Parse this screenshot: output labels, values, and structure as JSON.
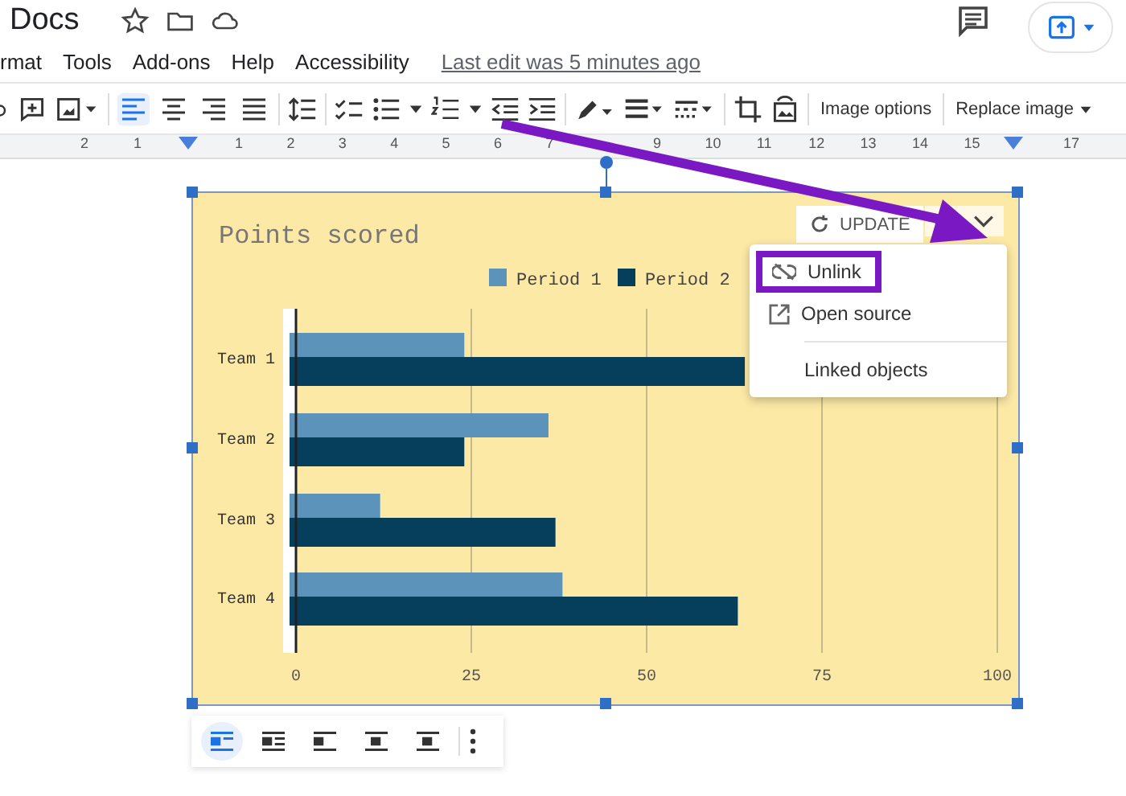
{
  "header": {
    "title": "Docs"
  },
  "menu": [
    "rmat",
    "Tools",
    "Add-ons",
    "Help",
    "Accessibility"
  ],
  "last_edit": "Last edit was 5 minutes ago",
  "alignment": [
    {
      "selected": true
    },
    {
      "selected": false
    },
    {
      "selected": false
    },
    {
      "selected": false
    }
  ],
  "toolbar_text_buttons": [
    "Image options",
    "Replace image"
  ],
  "ruler": [
    [
      "2",
      "1"
    ],
    [
      "1",
      "2",
      "3",
      "4",
      "5",
      "6",
      "7"
    ],
    [
      "9",
      "10",
      "11",
      "12",
      "13",
      "14",
      "15"
    ],
    [
      "17"
    ]
  ],
  "chart": {
    "update_button": "UPDATE",
    "chart_data": {
      "type": "bar",
      "orientation": "horizontal",
      "title": "Points scored",
      "categories": [
        "Team 1",
        "Team 2",
        "Team 3",
        "Team 4"
      ],
      "series": [
        {
          "name": "Period 1",
          "color": "#5b93ba",
          "values": [
            24,
            36,
            12,
            38
          ]
        },
        {
          "name": "Period 2",
          "color": "#063f5c",
          "values": [
            64,
            24,
            37,
            63
          ]
        }
      ],
      "xlim": [
        0,
        100
      ],
      "xticks": [
        0,
        25,
        50,
        75,
        100
      ],
      "grid": true,
      "legend": true
    }
  },
  "link_menu": [
    {
      "kind": "unlink",
      "label": "Unlink",
      "highlighted": true
    },
    {
      "kind": "open",
      "label": "Open source",
      "highlighted": false
    },
    {
      "kind": "divider-item",
      "label": "Linked objects",
      "highlighted": false
    }
  ],
  "wrap_options": [
    {
      "selected": true
    },
    {
      "selected": false
    },
    {
      "selected": false
    },
    {
      "selected": false
    },
    {
      "selected": false
    }
  ]
}
